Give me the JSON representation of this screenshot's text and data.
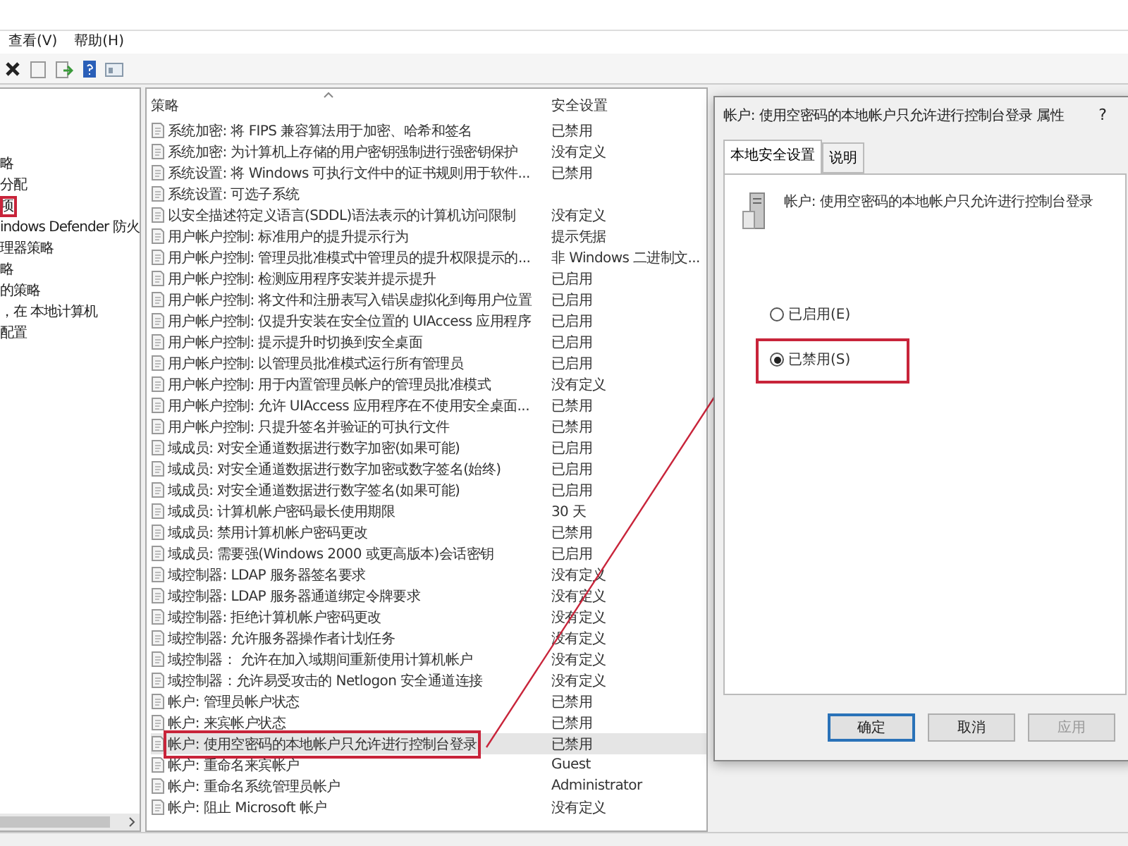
{
  "menu": [
    {
      "label": "查看(V)"
    },
    {
      "label": "帮助(H)"
    }
  ],
  "tree": [
    {
      "label": "略",
      "circled": false
    },
    {
      "label": "分配",
      "circled": false
    },
    {
      "label": "项",
      "circled": true
    },
    {
      "label": "indows Defender 防火",
      "circled": false
    },
    {
      "label": "理器策略",
      "circled": false
    },
    {
      "label": "略",
      "circled": false
    },
    {
      "label": "的策略",
      "circled": false
    },
    {
      "label": "，在 本地计算机",
      "circled": false
    },
    {
      "label": "配置",
      "circled": false
    }
  ],
  "table": {
    "columns": [
      "策略",
      "安全设置"
    ],
    "rows": [
      {
        "policy": "系统加密: 将 FIPS 兼容算法用于加密、哈希和签名",
        "setting": "已禁用",
        "selected": false
      },
      {
        "policy": "系统加密: 为计算机上存储的用户密钥强制进行强密钥保护",
        "setting": "没有定义",
        "selected": false
      },
      {
        "policy": "系统设置: 将 Windows 可执行文件中的证书规则用于软件...",
        "setting": "已禁用",
        "selected": false
      },
      {
        "policy": "系统设置: 可选子系统",
        "selected": false
      },
      {
        "policy": "以安全描述符定义语言(SDDL)语法表示的计算机访问限制",
        "setting": "没有定义",
        "selected": false
      },
      {
        "policy": "用户帐户控制: 标准用户的提升提示行为",
        "setting": "提示凭据",
        "selected": false
      },
      {
        "policy": "用户帐户控制: 管理员批准模式中管理员的提升权限提示的...",
        "setting": "非 Windows 二进制文...",
        "selected": false
      },
      {
        "policy": "用户帐户控制: 检测应用程序安装并提示提升",
        "setting": "已启用",
        "selected": false
      },
      {
        "policy": "用户帐户控制: 将文件和注册表写入错误虚拟化到每用户位置",
        "setting": "已启用",
        "selected": false
      },
      {
        "policy": "用户帐户控制: 仅提升安装在安全位置的 UIAccess 应用程序",
        "setting": "已启用",
        "selected": false
      },
      {
        "policy": "用户帐户控制: 提示提升时切换到安全桌面",
        "setting": "已启用",
        "selected": false
      },
      {
        "policy": "用户帐户控制: 以管理员批准模式运行所有管理员",
        "setting": "已启用",
        "selected": false
      },
      {
        "policy": "用户帐户控制: 用于内置管理员帐户的管理员批准模式",
        "setting": "没有定义",
        "selected": false
      },
      {
        "policy": "用户帐户控制: 允许 UIAccess 应用程序在不使用安全桌面...",
        "setting": "已禁用",
        "selected": false
      },
      {
        "policy": "用户帐户控制: 只提升签名并验证的可执行文件",
        "setting": "已禁用",
        "selected": false
      },
      {
        "policy": "域成员: 对安全通道数据进行数字加密(如果可能)",
        "setting": "已启用",
        "selected": false
      },
      {
        "policy": "域成员: 对安全通道数据进行数字加密或数字签名(始终)",
        "setting": "已启用",
        "selected": false
      },
      {
        "policy": "域成员: 对安全通道数据进行数字签名(如果可能)",
        "setting": "已启用",
        "selected": false
      },
      {
        "policy": "域成员: 计算机帐户密码最长使用期限",
        "setting": "30 天",
        "selected": false
      },
      {
        "policy": "域成员: 禁用计算机帐户密码更改",
        "setting": "已禁用",
        "selected": false
      },
      {
        "policy": "域成员: 需要强(Windows 2000 或更高版本)会话密钥",
        "setting": "已启用",
        "selected": false
      },
      {
        "policy": "域控制器: LDAP 服务器签名要求",
        "setting": "没有定义",
        "selected": false
      },
      {
        "policy": "域控制器: LDAP 服务器通道绑定令牌要求",
        "setting": "没有定义",
        "selected": false
      },
      {
        "policy": "域控制器: 拒绝计算机帐户密码更改",
        "setting": "没有定义",
        "selected": false
      },
      {
        "policy": "域控制器: 允许服务器操作者计划任务",
        "setting": "没有定义",
        "selected": false
      },
      {
        "policy": "域控制器： 允许在加入域期间重新使用计算机帐户",
        "setting": "没有定义",
        "selected": false
      },
      {
        "policy": "域控制器：允许易受攻击的 Netlogon 安全通道连接",
        "setting": "没有定义",
        "selected": false
      },
      {
        "policy": "帐户: 管理员帐户状态",
        "setting": "已禁用",
        "selected": false
      },
      {
        "policy": "帐户: 来宾帐户状态",
        "setting": "已禁用",
        "selected": false
      },
      {
        "policy": "帐户: 使用空密码的本地帐户只允许进行控制台登录",
        "setting": "已禁用",
        "selected": true
      },
      {
        "policy": "帐户: 重命名来宾帐户",
        "setting": "Guest",
        "selected": false
      },
      {
        "policy": "帐户: 重命名系统管理员帐户",
        "setting": "Administrator",
        "selected": false
      },
      {
        "policy": "帐户: 阻止 Microsoft 帐户",
        "setting": "没有定义",
        "selected": false
      }
    ]
  },
  "dialog": {
    "title": "帐户: 使用空密码的本地帐户只允许进行控制台登录 属性",
    "help": "?",
    "tabs": [
      {
        "label": "本地安全设置",
        "selected": true
      },
      {
        "label": "说明",
        "selected": false
      }
    ],
    "policy": "帐户: 使用空密码的本地帐户只允许进行控制台登录",
    "options": [
      {
        "label": "已启用(E)",
        "selected": false,
        "circled": false
      },
      {
        "label": "已禁用(S)",
        "selected": true,
        "circled": true
      }
    ],
    "buttons": [
      {
        "label": "确定",
        "default": true,
        "disabled": false
      },
      {
        "label": "取消",
        "default": false,
        "disabled": false
      },
      {
        "label": "应用",
        "default": false,
        "disabled": true
      }
    ]
  }
}
